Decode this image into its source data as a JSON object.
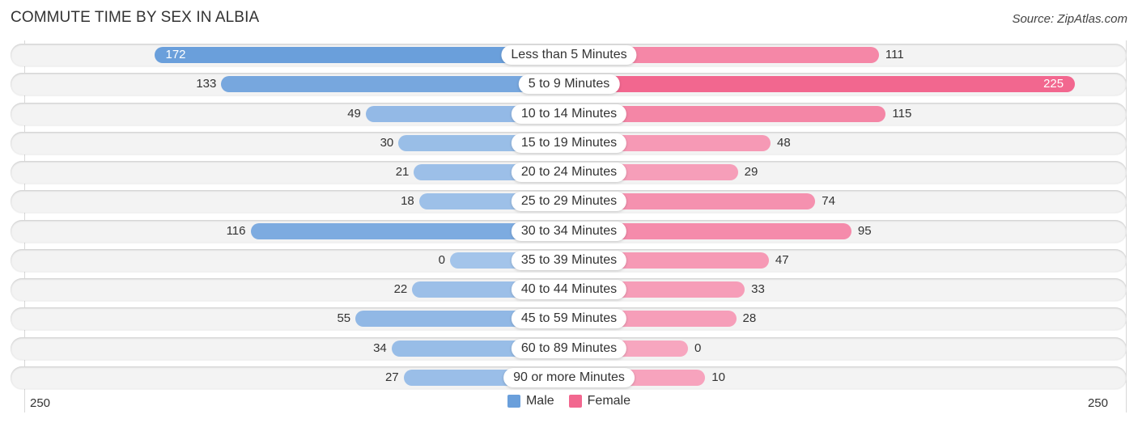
{
  "header": {
    "title": "COMMUTE TIME BY SEX IN ALBIA",
    "source": "Source: ZipAtlas.com"
  },
  "colors": {
    "male": "#6a9fdb",
    "male_light": "#a3c4ea",
    "female": "#f2678f",
    "female_light": "#f7a6bf"
  },
  "chart_data": {
    "type": "bar",
    "orientation": "horizontal-diverging",
    "title": "COMMUTE TIME BY SEX IN ALBIA",
    "categories": [
      "Less than 5 Minutes",
      "5 to 9 Minutes",
      "10 to 14 Minutes",
      "15 to 19 Minutes",
      "20 to 24 Minutes",
      "25 to 29 Minutes",
      "30 to 34 Minutes",
      "35 to 39 Minutes",
      "40 to 44 Minutes",
      "45 to 59 Minutes",
      "60 to 89 Minutes",
      "90 or more Minutes"
    ],
    "series": [
      {
        "name": "Male",
        "values": [
          172,
          133,
          49,
          30,
          21,
          18,
          116,
          0,
          22,
          55,
          34,
          27
        ]
      },
      {
        "name": "Female",
        "values": [
          111,
          225,
          115,
          48,
          29,
          74,
          95,
          47,
          33,
          28,
          0,
          10
        ]
      }
    ],
    "axis": {
      "left_label": "250",
      "right_label": "250",
      "max": 250
    },
    "legend": {
      "position": "bottom-center",
      "entries": [
        "Male",
        "Female"
      ]
    },
    "grid": false
  }
}
